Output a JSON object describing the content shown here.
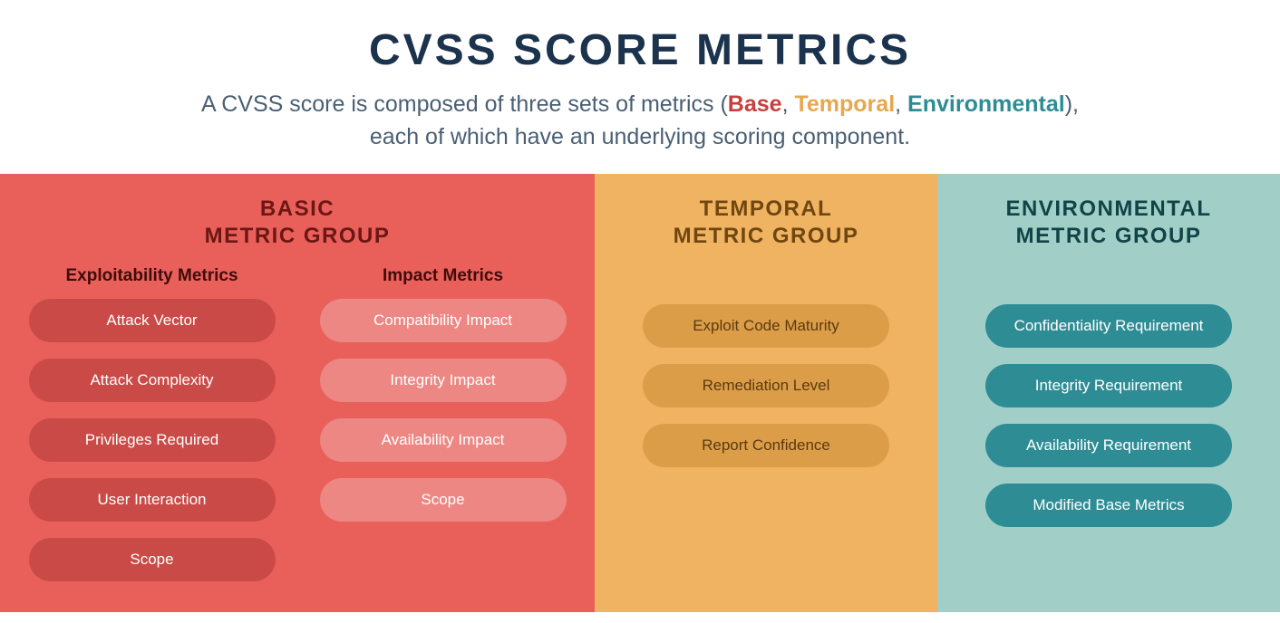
{
  "header": {
    "title": "CVSS SCORE METRICS",
    "sub_prefix": "A CVSS score is composed of three sets of metrics (",
    "kw_base": "Base",
    "sep1": ", ",
    "kw_temporal": "Temporal",
    "sep2": ", ",
    "kw_env": "Environmental",
    "sub_mid": "),",
    "sub_line2": "each of which have an underlying scoring component."
  },
  "groups": {
    "basic": {
      "title_line1": "BASIC",
      "title_line2": "METRIC GROUP",
      "exploit_head": "Exploitability Metrics",
      "impact_head": "Impact Metrics",
      "exploit": [
        "Attack Vector",
        "Attack Complexity",
        "Privileges Required",
        "User Interaction",
        "Scope"
      ],
      "impact": [
        "Compatibility Impact",
        "Integrity Impact",
        "Availability Impact",
        "Scope"
      ]
    },
    "temporal": {
      "title_line1": "TEMPORAL",
      "title_line2": "METRIC GROUP",
      "items": [
        "Exploit Code Maturity",
        "Remediation Level",
        "Report Confidence"
      ]
    },
    "env": {
      "title_line1": "ENVIRONMENTAL",
      "title_line2": "METRIC GROUP",
      "items": [
        "Confidentiality Requirement",
        "Integrity Requirement",
        "Availability Requirement",
        "Modified Base Metrics"
      ]
    }
  }
}
